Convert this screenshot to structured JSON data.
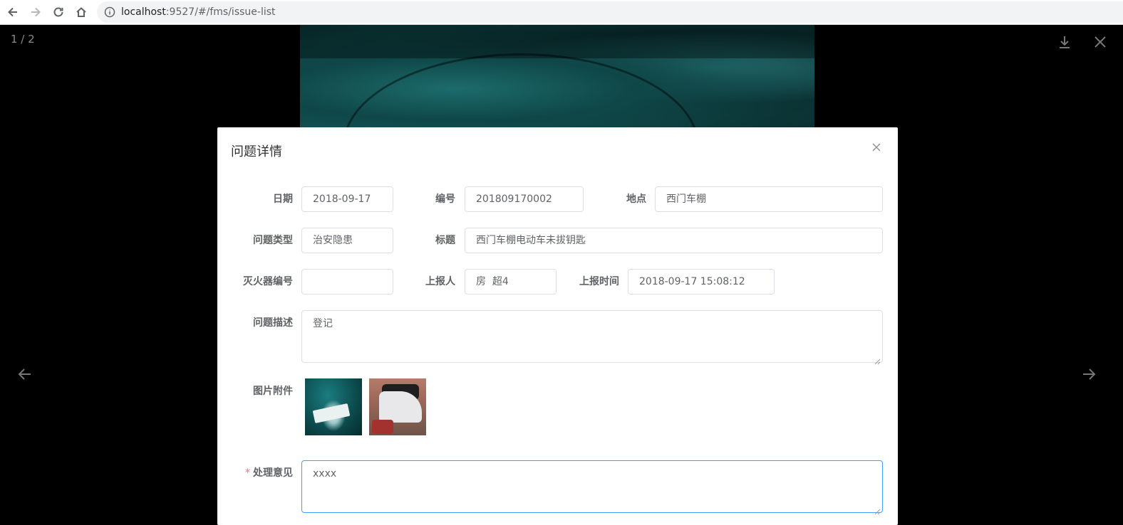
{
  "browser": {
    "url_host": "localhost",
    "url_rest": ":9527/#/fms/issue-list"
  },
  "viewer": {
    "counter": "1 / 2"
  },
  "dialog": {
    "title": "问题详情",
    "fields": {
      "date": {
        "label": "日期",
        "value": "2018-09-17"
      },
      "number": {
        "label": "编号",
        "value": "201809170002"
      },
      "location": {
        "label": "地点",
        "value": "西门车棚"
      },
      "issue_type": {
        "label": "问题类型",
        "value": "治安隐患"
      },
      "title": {
        "label": "标题",
        "value": "西门车棚电动车未拔钥匙"
      },
      "extinguisher_no": {
        "label": "灭火器编号",
        "value": ""
      },
      "reporter": {
        "label": "上报人",
        "value": "房  超4"
      },
      "report_time": {
        "label": "上报时间",
        "value": "2018-09-17 15:08:12"
      },
      "description": {
        "label": "问题描述",
        "value": "登记"
      },
      "attachments": {
        "label": "图片附件"
      },
      "opinion": {
        "label": "处理意见",
        "required_mark": "*",
        "value": "xxxx"
      }
    }
  }
}
